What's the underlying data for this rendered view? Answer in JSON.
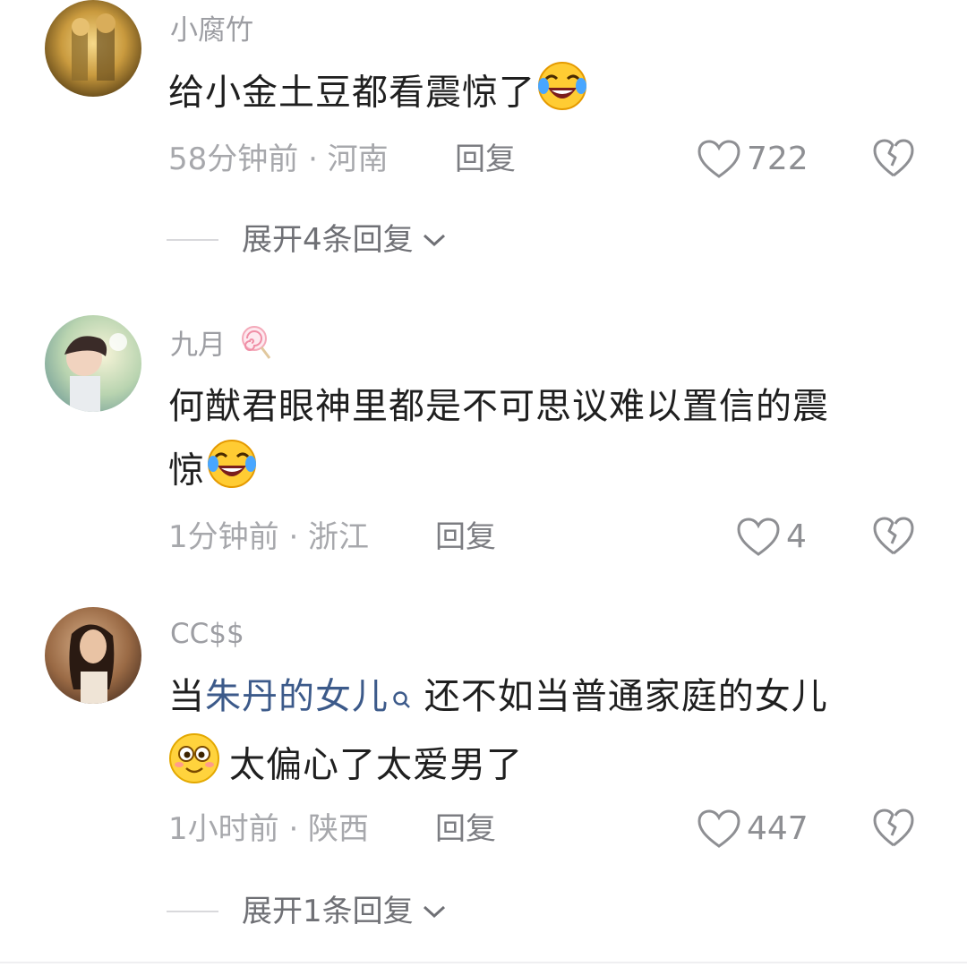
{
  "comments": [
    {
      "username": "小腐竹",
      "text": "给小金土豆都看震惊了",
      "time_location": "58分钟前 · 河南",
      "reply_label": "回复",
      "likes": "722",
      "expand_label": "展开4条回复"
    },
    {
      "username": "九月",
      "text_line1": "何猷君眼神里都是不可思议难以置信的震",
      "text_line2": "惊",
      "time_location": "1分钟前 · 浙江",
      "reply_label": "回复",
      "likes": "4"
    },
    {
      "username": "CC$$",
      "text_prefix": "当",
      "text_link": "朱丹的女儿",
      "text_suffix": " 还不如当普通家庭的女儿",
      "text_line2": "太偏心了太爱男了",
      "time_location": "1小时前 · 陕西",
      "reply_label": "回复",
      "likes": "447",
      "expand_label": "展开1条回复"
    }
  ],
  "colors": {
    "link": "#3c5a8a",
    "muted": "#a7a8ac",
    "text": "#1f1f1f"
  },
  "icons": [
    "heart-outline-icon",
    "broken-heart-icon",
    "chevron-down-icon",
    "laughing-tears-emoji",
    "smiling-emoji",
    "lollipop-badge-icon",
    "search-suggest-icon"
  ]
}
